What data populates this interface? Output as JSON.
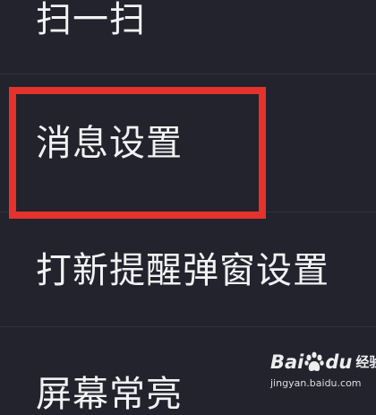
{
  "menu": {
    "items": [
      {
        "label": "扫一扫"
      },
      {
        "label": "消息设置"
      },
      {
        "label": "打新提醒弹窗设置"
      },
      {
        "label": "屏幕常亮"
      }
    ]
  },
  "highlight": {
    "color": "#e5322d",
    "target": "消息设置"
  },
  "watermark": {
    "brand_left": "Bai",
    "brand_right": "du",
    "brand_icon": "paw-icon",
    "product": "经验",
    "url": "jingyan.baidu.com"
  },
  "colors": {
    "background": "#22232c",
    "text": "#f2f2f4",
    "divider": "#31323c"
  }
}
